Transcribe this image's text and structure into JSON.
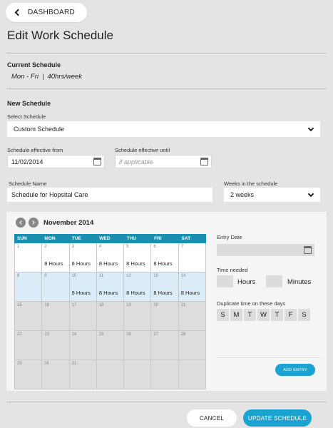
{
  "header": {
    "back_label": "DASHBOARD",
    "title": "Edit Work Schedule"
  },
  "current": {
    "heading": "Current Schedule",
    "days": "Mon - Fri",
    "separator": "|",
    "hours": "40hrs/week"
  },
  "new_schedule": {
    "heading": "New Schedule",
    "select_label": "Select Schedule",
    "select_value": "Custom Schedule",
    "from_label": "Schedule effective from",
    "from_value": "11/02/2014",
    "until_label": "Schedule effective until",
    "until_placeholder": "if applicable",
    "name_label": "Schedule Name",
    "name_value": "Schedule for Hopsital Care",
    "weeks_label": "Weeks in the schedule",
    "weeks_value": "2 weeks"
  },
  "calendar": {
    "month": "November 2014",
    "weekdays": [
      "SUN",
      "MON",
      "TUE",
      "WED",
      "THU",
      "FRI",
      "SAT"
    ],
    "weeks": [
      [
        {
          "d": "1",
          "h": ""
        },
        {
          "d": "2",
          "h": "8 Hours"
        },
        {
          "d": "3",
          "h": "8 Hours"
        },
        {
          "d": "4",
          "h": "8 Hours"
        },
        {
          "d": "5",
          "h": "8 Hours"
        },
        {
          "d": "6",
          "h": "8 Hours"
        },
        {
          "d": "7",
          "h": ""
        }
      ],
      [
        {
          "d": "8",
          "h": ""
        },
        {
          "d": "9",
          "h": ""
        },
        {
          "d": "10",
          "h": "8 Hours"
        },
        {
          "d": "11",
          "h": "8 Hours"
        },
        {
          "d": "12",
          "h": "8 Hours"
        },
        {
          "d": "13",
          "h": "8 Hours"
        },
        {
          "d": "14",
          "h": "8 Hours"
        }
      ],
      [
        {
          "d": "15",
          "h": ""
        },
        {
          "d": "16",
          "h": ""
        },
        {
          "d": "17",
          "h": ""
        },
        {
          "d": "18",
          "h": ""
        },
        {
          "d": "19",
          "h": ""
        },
        {
          "d": "20",
          "h": ""
        },
        {
          "d": "21",
          "h": ""
        }
      ],
      [
        {
          "d": "22",
          "h": ""
        },
        {
          "d": "23",
          "h": ""
        },
        {
          "d": "24",
          "h": ""
        },
        {
          "d": "25",
          "h": ""
        },
        {
          "d": "26",
          "h": ""
        },
        {
          "d": "27",
          "h": ""
        },
        {
          "d": "28",
          "h": ""
        }
      ],
      [
        {
          "d": "29",
          "h": ""
        },
        {
          "d": "30",
          "h": ""
        },
        {
          "d": "31",
          "h": ""
        },
        {
          "d": "",
          "h": ""
        },
        {
          "d": "",
          "h": ""
        },
        {
          "d": "",
          "h": ""
        },
        {
          "d": "",
          "h": ""
        }
      ]
    ]
  },
  "entry": {
    "date_label": "Entry Date",
    "time_label": "Time needed",
    "hours_label": "Hours",
    "minutes_label": "Minutes",
    "dup_label": "Duplicate time on these days",
    "days": [
      "S",
      "M",
      "T",
      "W",
      "T",
      "F",
      "S"
    ],
    "add_label": "ADD ENTRY"
  },
  "footer": {
    "cancel_label": "CANCEL",
    "update_label": "UPDATE SCHEDULE"
  },
  "colors": {
    "accent": "#1ba3d1",
    "calendar_header": "#1b8fb0",
    "week_highlight": "#d9ecf7"
  }
}
